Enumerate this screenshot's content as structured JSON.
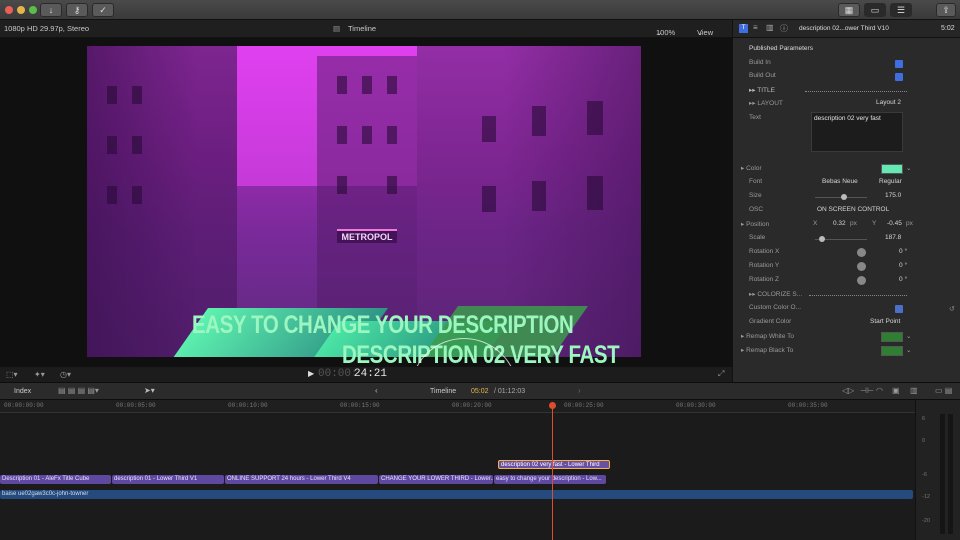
{
  "toolbar": {
    "icons": [
      "download-icon",
      "key-icon",
      "checkmark-icon",
      "grid-icon",
      "film-strip-icon",
      "sliders-icon",
      "share-icon"
    ]
  },
  "viewer": {
    "format": "1080p HD 29.97p, Stereo",
    "title": "Timeline",
    "zoom": "100%",
    "view_label": "View",
    "timecode_dim": "00:00:",
    "timecode": "24:21",
    "title_line1": "EASY TO CHANGE YOUR DESCRIPTION",
    "title_line2": "DESCRIPTION 02 VERY FAST",
    "sign_text": "METROPOL"
  },
  "inspector": {
    "clip_name": "description 02...ower Third V10",
    "duration": "5:02",
    "section": "Published Parameters",
    "params": [
      {
        "label": "Build In",
        "type": "checkbox",
        "checked": true
      },
      {
        "label": "Build Out",
        "type": "checkbox",
        "checked": true
      },
      {
        "label": "TITLE",
        "type": "group"
      },
      {
        "label": "LAYOUT",
        "type": "popup",
        "value": "Layout 2"
      },
      {
        "label": "Text",
        "type": "text",
        "value": "description 02 very fast"
      },
      {
        "label": "Color",
        "type": "color",
        "value": "#64e9b3"
      },
      {
        "label": "Font",
        "type": "font",
        "value": "Bebas Neue",
        "value2": "Regular"
      },
      {
        "label": "Size",
        "type": "slider",
        "value": "175.0"
      },
      {
        "label": "OSC",
        "type": "popup",
        "value": "ON SCREEN CONTROL"
      },
      {
        "label": "Position",
        "type": "xy",
        "x_label": "X",
        "x": "0.32",
        "x_unit": "px",
        "y_label": "Y",
        "y": "-0.45",
        "y_unit": "px"
      },
      {
        "label": "Scale",
        "type": "slider",
        "value": "187.8"
      },
      {
        "label": "Rotation X",
        "type": "knob",
        "value": "0",
        "unit": "°"
      },
      {
        "label": "Rotation Y",
        "type": "knob",
        "value": "0",
        "unit": "°"
      },
      {
        "label": "Rotation Z",
        "type": "knob",
        "value": "0",
        "unit": "°"
      },
      {
        "label": "COLORIZE S...",
        "type": "group"
      },
      {
        "label": "Custom Color O...",
        "type": "checkbox",
        "checked": true
      },
      {
        "label": "Gradient Color",
        "type": "popup",
        "value": "Start Point"
      },
      {
        "label": "Remap White To",
        "type": "color",
        "value": "#2f7f33"
      },
      {
        "label": "Remap Black To",
        "type": "color",
        "value": "#2f7f33"
      }
    ]
  },
  "timeline": {
    "index_label": "Index",
    "title": "Timeline",
    "position": "05:02",
    "total": "/ 01:12:03",
    "ruler": [
      "00:00:00:00",
      "00:00:05:00",
      "00:00:10:00",
      "00:00:15:00",
      "00:00:20:00",
      "00:00:25:00",
      "00:00:30:00",
      "00:00:35:00"
    ],
    "connected_clip": "description 02 very fast - Lower Third",
    "clips": [
      "Description 01 - AleFx Title Cube",
      "description 01 - Lower Third V1",
      "ONLINE SUPPORT 24 hours - Lower Third V4",
      "CHANGE YOUR LOWER THIRD - Lower...",
      "easy to change your description - Low..."
    ],
    "audio_clip": "baise ue02gaw3c0c-john-towner",
    "meter_labels": [
      "6",
      "0",
      "-6",
      "-12",
      "-20"
    ]
  }
}
